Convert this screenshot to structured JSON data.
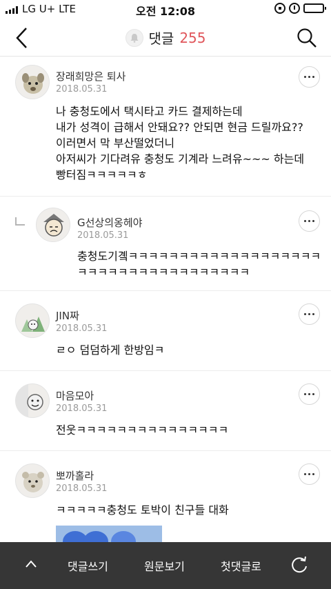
{
  "status_bar": {
    "carrier": "LG U+  LTE",
    "time": "오전 12:08",
    "battery_level": 0.2
  },
  "nav": {
    "title": "댓글",
    "count": "255"
  },
  "comments": [
    {
      "author": "장래희망은 퇴사",
      "date": "2018.05.31",
      "text": "나 충청도에서 택시타고 카드 결제하는데\n내가 성격이 급해서 안돼요?? 안되면 현금 드릴까요??\n이러면서 막 부산떨었더니\n아저씨가 기다려유 충청도 기계라 느려유~~~ 하는데\n빵터짐ㅋㅋㅋㅋㅋㅎ"
    },
    {
      "author": "G선상의옹헤야",
      "date": "2018.05.31",
      "text": "충청도기곜ㅋㅋㅋㅋㅋㅋㅋㅋㅋㅋㅋㅋㅋㅋㅋㅋㅋㅋㅋ\nㅋㅋㅋㅋㅋㅋㅋㅋㅋㅋㅋㅋㅋㅋㅋㅋㅋ",
      "is_reply": true
    },
    {
      "author": "JIN짜",
      "date": "2018.05.31",
      "text": "ㄹㅇ 덤덤하게 한방임ㅋ"
    },
    {
      "author": "마음모아",
      "date": "2018.05.31",
      "text": "전웃ㅋㅋㅋㅋㅋㅋㅋㅋㅋㅋㅋㅋㅋㅋㅋ"
    },
    {
      "author": "뽀까홀라",
      "date": "2018.05.31",
      "text": "ㅋㅋㅋㅋㅋ충청도 토박이 친구들 대화"
    }
  ],
  "bottom_bar": {
    "write_label": "댓글쓰기",
    "original_label": "원문보기",
    "first_label": "첫댓글로"
  },
  "colors": {
    "accent": "#e0565b",
    "bottom_bar": "#363636"
  }
}
